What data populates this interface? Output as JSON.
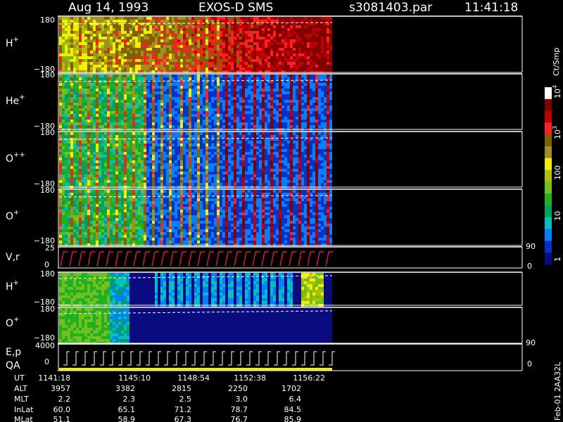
{
  "header": {
    "date": "Aug 14, 1993",
    "instrument": "EXOS-D SMS",
    "file": "s3081403.par",
    "time": "11:41:18"
  },
  "panels": [
    {
      "id": "hplus1",
      "label": "H",
      "sup": "+",
      "ytop": "180",
      "ybot": "−180"
    },
    {
      "id": "heplus",
      "label": "He",
      "sup": "+",
      "ytop": "180",
      "ybot": "−180"
    },
    {
      "id": "oplusplus",
      "label": "O",
      "sup": "++",
      "ytop": "180",
      "ybot": "−180"
    },
    {
      "id": "oplus1",
      "label": "O",
      "sup": "+",
      "ytop": "180",
      "ybot": "−180"
    },
    {
      "id": "vr",
      "label": "V,r",
      "sup": "",
      "ytop": "25",
      "ybot": "0",
      "rtop": "90",
      "rbot": "0"
    },
    {
      "id": "hplus2",
      "label": "H",
      "sup": "+",
      "ytop": "180",
      "ybot": "−180"
    },
    {
      "id": "oplus2",
      "label": "O",
      "sup": "+",
      "ytop": "180",
      "ybot": "−180"
    },
    {
      "id": "ep",
      "label": "E,p",
      "label2": "QA",
      "sup": "",
      "ytop": "4000",
      "ybot": "0",
      "rtop": "90",
      "rbot": "0"
    }
  ],
  "colorbar": {
    "unit": "Ct/Smp",
    "ticks": [
      {
        "base": "10",
        "exp": "4"
      },
      {
        "base": "10",
        "exp": "3"
      },
      {
        "base": "100",
        "exp": ""
      },
      {
        "base": "10",
        "exp": ""
      },
      {
        "base": "1",
        "exp": ""
      }
    ],
    "colors": [
      "#0b0b80",
      "#0033cc",
      "#0080ff",
      "#00c0c0",
      "#00a060",
      "#20b020",
      "#70c020",
      "#b0c000",
      "#f0f000",
      "#a09020",
      "#806000",
      "#ff2020",
      "#c00000",
      "#800000",
      "#ffffff"
    ]
  },
  "orbit": {
    "rows": [
      {
        "name": "UT",
        "values": [
          "1141:18",
          "1145:10",
          "1148:54",
          "1152:38",
          "1156:22"
        ]
      },
      {
        "name": "ALT",
        "values": [
          "3957",
          "3382",
          "2815",
          "2250",
          "1702"
        ]
      },
      {
        "name": "MLT",
        "values": [
          "2.2",
          "2.3",
          "2.5",
          "3.0",
          "6.4"
        ]
      },
      {
        "name": "InLat",
        "values": [
          "60.0",
          "65.1",
          "71.2",
          "78.7",
          "84.5"
        ]
      },
      {
        "name": "MLat",
        "values": [
          "51.1",
          "58.9",
          "67.3",
          "76.7",
          "85.9"
        ]
      }
    ]
  },
  "footer_note": "Feb-01 2AA32L"
}
